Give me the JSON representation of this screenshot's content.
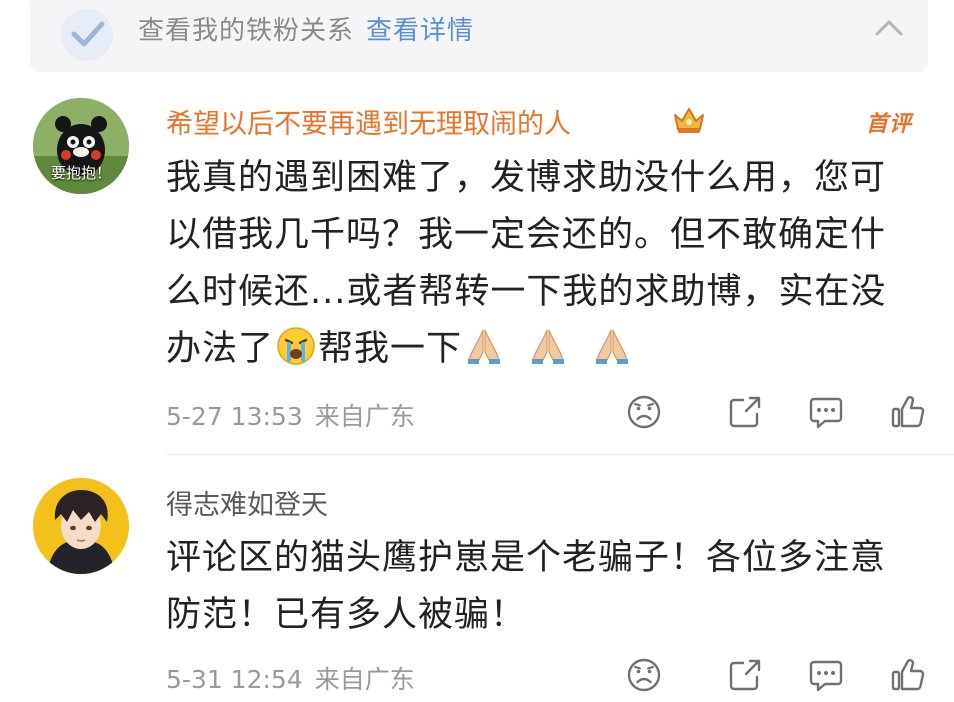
{
  "banner": {
    "text": "查看我的铁粉关系",
    "link": "查看详情",
    "close_icon": "close-icon"
  },
  "comments": [
    {
      "username": "希望以后不要再遇到无理取闹的人",
      "badge_icon": "crown-icon",
      "first_comment_label": "首评",
      "avatar_text": "要抱抱！",
      "body_parts": [
        "我真的遇到困难了，发博求助没什么用，您可以借我几千吗？我一定会还的。但不敢确定什么时候还...或者帮转一下我的求助博，实在没办法了",
        "帮我一下"
      ],
      "emojis": [
        "crying-face-emoji",
        "praying-hands-emoji",
        "praying-hands-emoji",
        "praying-hands-emoji"
      ],
      "time": "5-27 13:53",
      "location": "来自广东",
      "actions": [
        "dislike-face-icon",
        "share-icon",
        "comment-icon",
        "like-thumb-icon"
      ]
    },
    {
      "username": "得志难如登天",
      "body": "评论区的猫头鹰护崽是个老骗子！各位多注意防范！已有多人被骗！",
      "time": "5-31 12:54",
      "location": "来自广东",
      "actions": [
        "dislike-face-icon",
        "share-icon",
        "comment-icon",
        "like-thumb-icon"
      ]
    }
  ],
  "colors": {
    "vip_name": "#e8732b",
    "link": "#5a8fd6",
    "text": "#222222",
    "meta": "#9a9a9a"
  }
}
